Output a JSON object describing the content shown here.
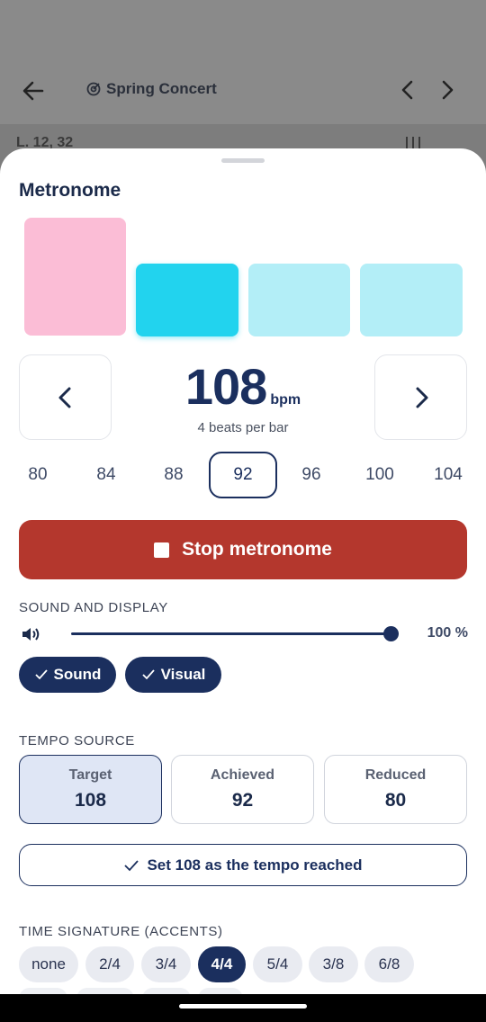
{
  "app_bar": {
    "title": "Spring Concert",
    "back_icon": "arrow-left-icon",
    "title_icon": "target-icon",
    "prev_icon": "chevron-left-icon",
    "next_icon": "chevron-right-icon"
  },
  "background_peek": {
    "text": "L. 12, 32"
  },
  "metronome": {
    "title": "Metronome",
    "beats": [
      {
        "index": 1,
        "color": "#fbbdd6",
        "state": "accent"
      },
      {
        "index": 2,
        "color": "#22d3ee",
        "state": "active"
      },
      {
        "index": 3,
        "color": "#b3eef7",
        "state": "idle"
      },
      {
        "index": 4,
        "color": "#b3eef7",
        "state": "idle"
      }
    ],
    "bpm": {
      "value": "108",
      "unit": "bpm",
      "subtitle": "4 beats per bar",
      "decrease_icon": "chevron-left-icon",
      "increase_icon": "chevron-right-icon"
    },
    "presets": [
      "80",
      "84",
      "88",
      "92",
      "96",
      "100",
      "104"
    ],
    "selected_preset": "92",
    "stop_button": {
      "label": "Stop metronome",
      "icon": "stop-icon",
      "color": "#b4372d"
    }
  },
  "sound_display": {
    "label": "SOUND AND DISPLAY",
    "volume_icon": "speaker-icon",
    "volume": 1.0,
    "volume_text": "100 %",
    "chips": [
      {
        "label": "Sound",
        "checked": true
      },
      {
        "label": "Visual",
        "checked": true
      }
    ]
  },
  "tempo_source": {
    "label": "TEMPO SOURCE",
    "options": [
      {
        "label": "Target",
        "value": "108",
        "selected": true
      },
      {
        "label": "Achieved",
        "value": "92",
        "selected": false
      },
      {
        "label": "Reduced",
        "value": "80",
        "selected": false
      }
    ],
    "set_button": {
      "label": "Set 108 as the tempo reached",
      "icon": "check-icon"
    }
  },
  "time_signature": {
    "label": "TIME SIGNATURE (ACCENTS)",
    "options": [
      "none",
      "2/4",
      "3/4",
      "4/4",
      "5/4",
      "3/8",
      "6/8"
    ],
    "selected": "4/4"
  },
  "colors": {
    "primary": "#1b2f5e",
    "danger": "#b4372d",
    "accent_beat": "#fbbdd6",
    "active_beat": "#22d3ee",
    "idle_beat": "#b3eef7"
  }
}
